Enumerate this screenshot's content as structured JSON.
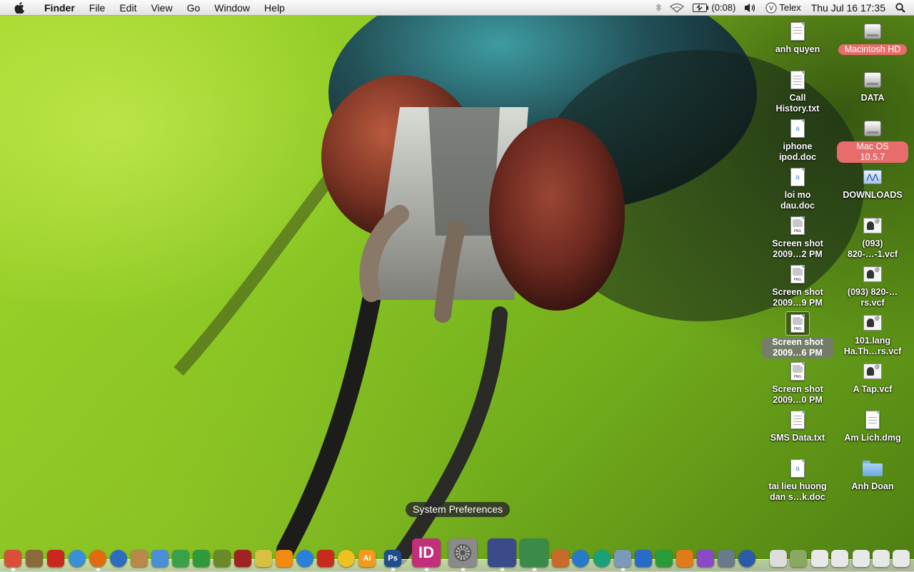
{
  "menubar": {
    "app_name": "Finder",
    "menus": [
      "File",
      "Edit",
      "View",
      "Go",
      "Window",
      "Help"
    ],
    "battery_time": "(0:08)",
    "input_method": "Telex",
    "clock": "Thu Jul 16  17:35"
  },
  "desktop": {
    "left_column": [
      {
        "label": "anh quyen",
        "icon": "text-document-icon"
      },
      {
        "label": "Call History.txt",
        "icon": "text-document-icon"
      },
      {
        "label": "iphone ipod.doc",
        "icon": "word-document-icon"
      },
      {
        "label": "loi mo dau.doc",
        "icon": "word-document-icon"
      },
      {
        "label": "Screen shot 2009…2 PM",
        "icon": "png-image-icon"
      },
      {
        "label": "Screen shot 2009…9 PM",
        "icon": "png-image-icon"
      },
      {
        "label": "Screen shot 2009…6 PM",
        "icon": "png-image-icon",
        "selected": true
      },
      {
        "label": "Screen shot 2009…0 PM",
        "icon": "png-image-icon"
      },
      {
        "label": "SMS Data.txt",
        "icon": "text-document-icon"
      },
      {
        "label": "tai lieu huong dan s…k.doc",
        "icon": "word-document-icon"
      }
    ],
    "right_column": [
      {
        "label": "Macintosh HD",
        "icon": "hard-drive-icon",
        "label_color": "#e86c6c"
      },
      {
        "label": "DATA",
        "icon": "hard-drive-icon"
      },
      {
        "label": "Mac OS 10.5.7",
        "icon": "hard-drive-icon",
        "label_color": "#e86c6c"
      },
      {
        "label": "DOWNLOADS",
        "icon": "network-drive-icon"
      },
      {
        "label": "(093) 820-…-1.vcf",
        "icon": "vcard-icon"
      },
      {
        "label": "(093) 820-…rs.vcf",
        "icon": "vcard-icon"
      },
      {
        "label": "101.lang Ha.Th…rs.vcf",
        "icon": "vcard-icon"
      },
      {
        "label": "A Tap.vcf",
        "icon": "vcard-icon"
      },
      {
        "label": "Am Lich.dmg",
        "icon": "disk-image-icon"
      },
      {
        "label": "Anh Doan",
        "icon": "folder-icon"
      }
    ]
  },
  "dock": {
    "tooltip": "System Preferences",
    "items": [
      {
        "name": "dashboard-icon",
        "color": "#d94f3a"
      },
      {
        "name": "photo-booth-icon",
        "color": "#8a6a3a"
      },
      {
        "name": "acrobat-icon",
        "color": "#c9281e"
      },
      {
        "name": "safari-icon",
        "color": "#3b8fd6"
      },
      {
        "name": "firefox-icon",
        "color": "#e06b12"
      },
      {
        "name": "google-earth-icon",
        "color": "#2d6cc0"
      },
      {
        "name": "address-book-icon",
        "color": "#b88a4a"
      },
      {
        "name": "mail-icon",
        "color": "#4c8dd8"
      },
      {
        "name": "colorsync-icon",
        "color": "#3aa04a"
      },
      {
        "name": "utorrent-icon",
        "color": "#2e9a3c"
      },
      {
        "name": "script-editor-icon",
        "color": "#6a8a2a"
      },
      {
        "name": "dictionary-icon",
        "color": "#a12222"
      },
      {
        "name": "cleaner-icon",
        "color": "#d8c040"
      },
      {
        "name": "vlc-icon",
        "color": "#f08a10"
      },
      {
        "name": "itunes-icon",
        "color": "#2a7fd8"
      },
      {
        "name": "flash-icon",
        "color": "#c82a1e"
      },
      {
        "name": "yahoo-messenger-icon",
        "color": "#f0c020"
      },
      {
        "name": "illustrator-icon",
        "color": "#f39a1e",
        "text": "Ai"
      },
      {
        "name": "photoshop-icon",
        "color": "#1e4e8c",
        "text": "Ps"
      },
      {
        "name": "indesign-icon",
        "color": "#c2307a",
        "text": "ID",
        "large": true
      },
      {
        "name": "system-preferences-icon",
        "color": "#8a8a8a",
        "large": true
      },
      {
        "name": "quill-icon",
        "color": "#3a4a8a",
        "large": true
      },
      {
        "name": "activity-chart-icon",
        "color": "#3a8a4a",
        "large": true
      },
      {
        "name": "presentation-icon",
        "color": "#c86a2a"
      },
      {
        "name": "home-icon",
        "color": "#2a78c8"
      },
      {
        "name": "network-icon",
        "color": "#1aa07a"
      },
      {
        "name": "trash-can-icon",
        "color": "#7a9ab8"
      },
      {
        "name": "word-icon",
        "color": "#2a6ac8"
      },
      {
        "name": "excel-icon",
        "color": "#2a9a3a"
      },
      {
        "name": "powerpoint-icon",
        "color": "#e07a1a"
      },
      {
        "name": "entourage-icon",
        "color": "#8a4ac8"
      },
      {
        "name": "preview-icon",
        "color": "#6a7a8a"
      },
      {
        "name": "time-machine-icon",
        "color": "#2a5aa8"
      },
      {
        "name": "minimized-window-1-icon",
        "color": "#dcdcdc"
      },
      {
        "name": "minimized-window-2-icon",
        "color": "#8aa860"
      },
      {
        "name": "minimized-window-3-icon",
        "color": "#e8e8e8"
      },
      {
        "name": "minimized-window-4-icon",
        "color": "#e8e8e8"
      },
      {
        "name": "minimized-window-5-icon",
        "color": "#e8e8e8"
      },
      {
        "name": "minimized-window-6-icon",
        "color": "#e8e8e8"
      },
      {
        "name": "minimized-window-7-icon",
        "color": "#e8e8e8"
      }
    ]
  }
}
